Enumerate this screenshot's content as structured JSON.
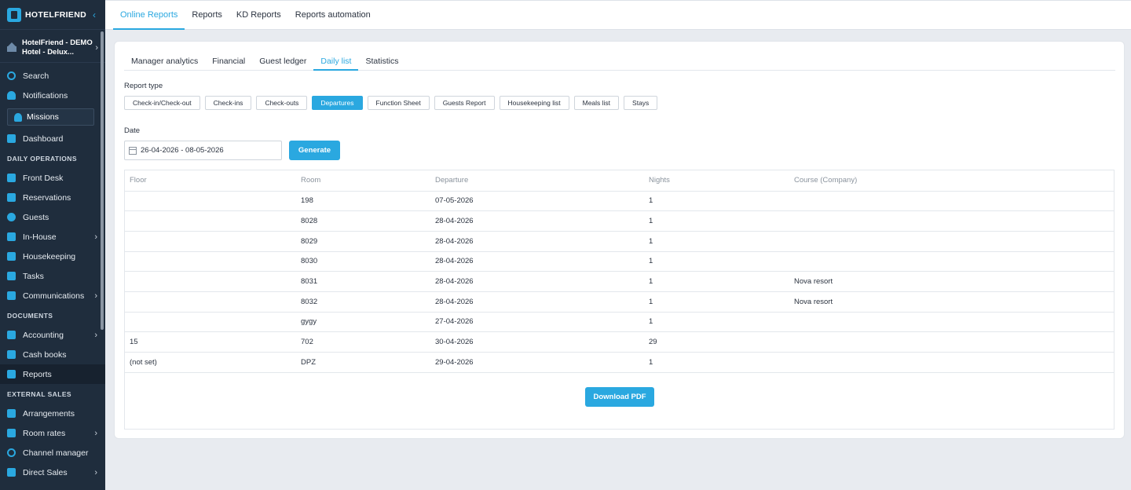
{
  "app": {
    "brand": "HOTELFRIEND",
    "hotel_name": "HotelFriend - DEMO Hotel - Delux..."
  },
  "sidebar": {
    "search": "Search",
    "notifications": "Notifications",
    "missions": "Missions",
    "dashboard": "Dashboard",
    "section_daily": "DAILY OPERATIONS",
    "front_desk": "Front Desk",
    "reservations": "Reservations",
    "guests": "Guests",
    "in_house": "In-House",
    "housekeeping": "Housekeeping",
    "tasks": "Tasks",
    "communications": "Communications",
    "section_documents": "DOCUMENTS",
    "accounting": "Accounting",
    "cash_books": "Cash books",
    "reports": "Reports",
    "section_external": "EXTERNAL SALES",
    "arrangements": "Arrangements",
    "room_rates": "Room rates",
    "channel_manager": "Channel manager",
    "direct_sales": "Direct Sales"
  },
  "topbar": {
    "tabs": [
      "Online Reports",
      "Reports",
      "KD Reports",
      "Reports automation"
    ],
    "active": "Online Reports"
  },
  "subtabs": {
    "items": [
      "Manager analytics",
      "Financial",
      "Guest ledger",
      "Daily list",
      "Statistics"
    ],
    "active": "Daily list"
  },
  "report_type": {
    "label": "Report type",
    "options": [
      "Check-in/Check-out",
      "Check-ins",
      "Check-outs",
      "Departures",
      "Function Sheet",
      "Guests Report",
      "Housekeeping list",
      "Meals list",
      "Stays"
    ],
    "selected": "Departures"
  },
  "date": {
    "label": "Date",
    "value": "26-04-2026 - 08-05-2026"
  },
  "generate_label": "Generate",
  "table": {
    "columns": [
      "Floor",
      "Room",
      "Departure",
      "Nights",
      "Course (Company)"
    ],
    "rows": [
      [
        "",
        "198",
        "07-05-2026",
        "1",
        ""
      ],
      [
        "",
        "8028",
        "28-04-2026",
        "1",
        ""
      ],
      [
        "",
        "8029",
        "28-04-2026",
        "1",
        ""
      ],
      [
        "",
        "8030",
        "28-04-2026",
        "1",
        ""
      ],
      [
        "",
        "8031",
        "28-04-2026",
        "1",
        "Nova resort"
      ],
      [
        "",
        "8032",
        "28-04-2026",
        "1",
        "Nova resort"
      ],
      [
        "",
        "gygy",
        "27-04-2026",
        "1",
        ""
      ],
      [
        "15",
        "702",
        "30-04-2026",
        "29",
        ""
      ],
      [
        "(not set)",
        "DPZ",
        "29-04-2026",
        "1",
        ""
      ]
    ]
  },
  "download_label": "Download PDF",
  "colors": {
    "accent": "#2aa8e0",
    "sidebar_bg": "#1f2d3d"
  }
}
